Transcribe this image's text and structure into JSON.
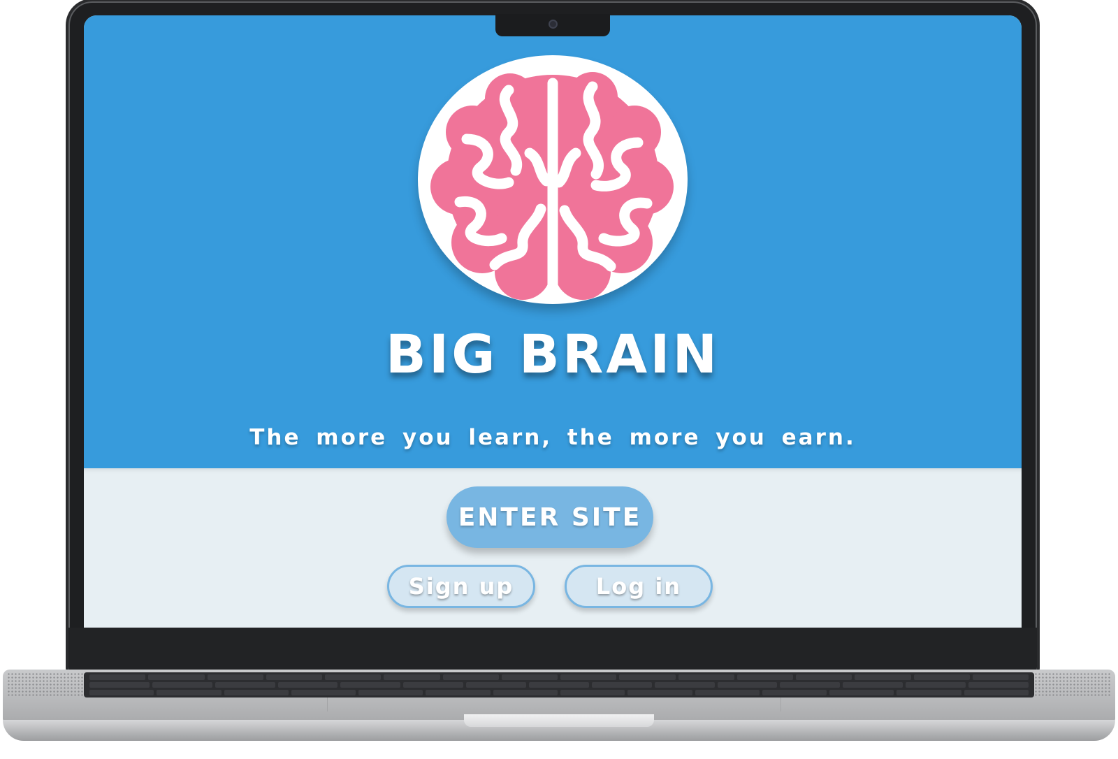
{
  "site": {
    "title": "BIG BRAIN",
    "tagline": "The more you learn, the more you earn."
  },
  "logo": {
    "icon": "brain-icon",
    "brain_color": "#f07499",
    "circle_color": "#ffffff"
  },
  "actions": {
    "enter_label": "ENTER SITE",
    "signup_label": "Sign up",
    "login_label": "Log in"
  },
  "colors": {
    "hero_background": "#379bdc",
    "actions_background": "#e7eff3",
    "enter_button": "#78b6e2",
    "small_button_fill": "#d5e6f2",
    "small_button_border": "#79b6e2"
  }
}
